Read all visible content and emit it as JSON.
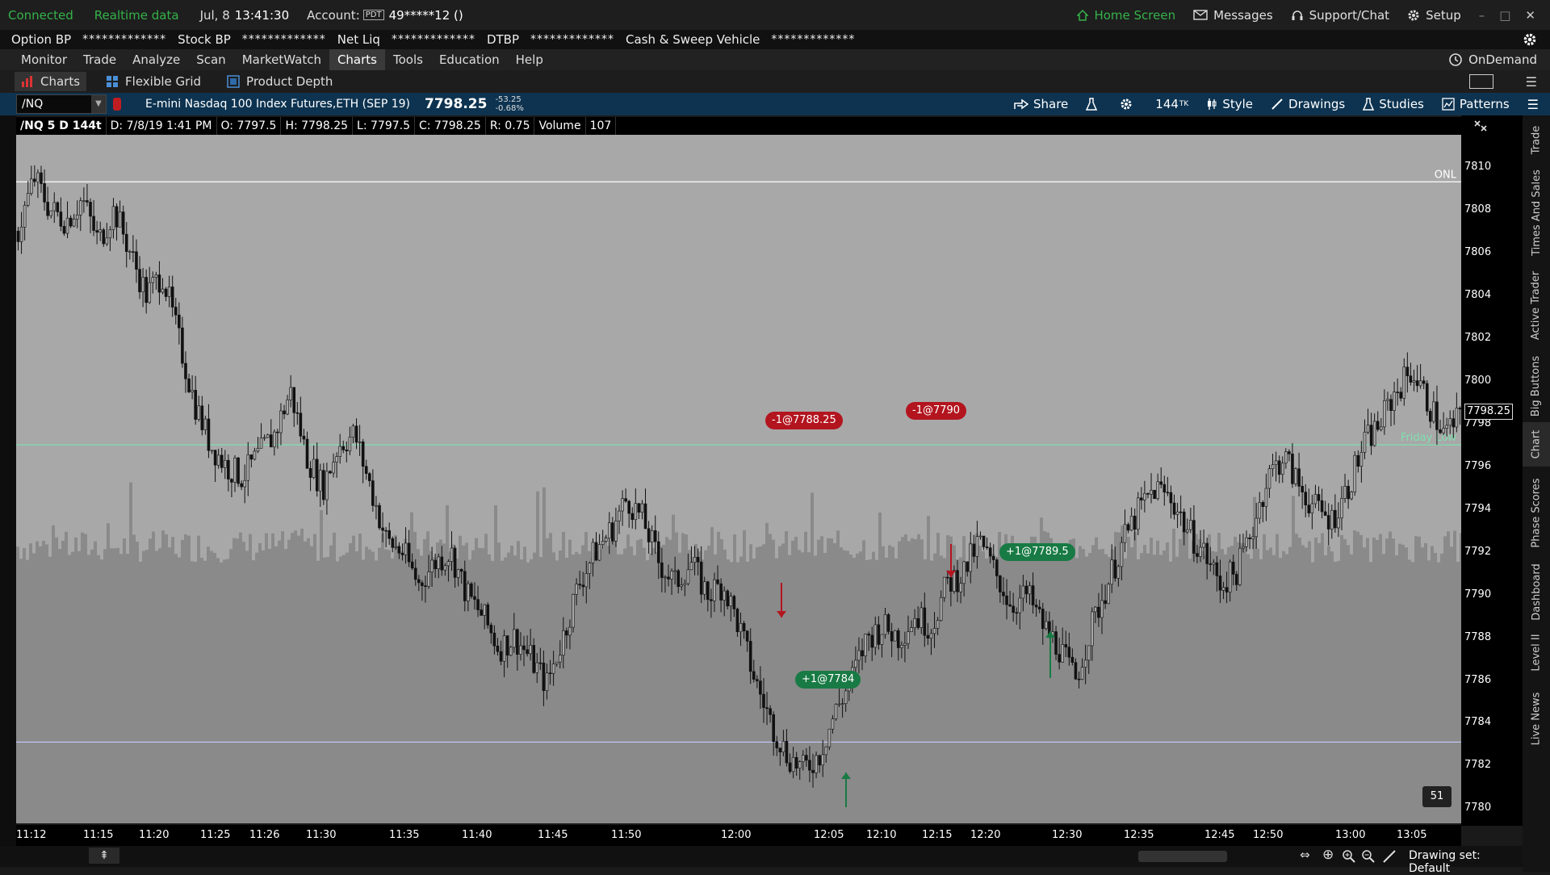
{
  "status": {
    "connected": "Connected",
    "realtime": "Realtime data",
    "date": "Jul, 8",
    "time": "13:41:30",
    "account_label": "Account:",
    "account_tag": "PDT",
    "account_value": "49*****12 ()",
    "home_screen": "Home Screen",
    "messages": "Messages",
    "support": "Support/Chat",
    "setup": "Setup"
  },
  "buying_power": [
    {
      "label": "Option BP",
      "value": "*************"
    },
    {
      "label": "Stock BP",
      "value": "*************"
    },
    {
      "label": "Net Liq",
      "value": "*************"
    },
    {
      "label": "DTBP",
      "value": "*************"
    },
    {
      "label": "Cash & Sweep Vehicle",
      "value": "*************"
    }
  ],
  "menu": [
    "Monitor",
    "Trade",
    "Analyze",
    "Scan",
    "MarketWatch",
    "Charts",
    "Tools",
    "Education",
    "Help"
  ],
  "ondemand": "OnDemand",
  "subtabs": [
    "Charts",
    "Flexible Grid",
    "Product Depth"
  ],
  "symbol": {
    "ticker": "/NQ",
    "description": "E-mini Nasdaq 100 Index Futures,ETH (SEP 19)",
    "price": "7798.25",
    "change": "-53.25",
    "change_pct": "-0.68%"
  },
  "toolbar": {
    "share": "Share",
    "ticks": "144",
    "ticks_unit": "TK",
    "style": "Style",
    "drawings": "Drawings",
    "studies": "Studies",
    "patterns": "Patterns"
  },
  "ohlc": {
    "title": "/NQ 5 D 144t",
    "date": "D: 7/8/19 1:41 PM",
    "open": "O: 7797.5",
    "high": "H: 7798.25",
    "low": "L: 7797.5",
    "close": "C: 7798.25",
    "range": "R: 0.75",
    "volume_label": "Volume",
    "volume_value": "107"
  },
  "right_tabs": [
    "Trade",
    "Times And Sales",
    "Active Trader",
    "Big Buttons",
    "Chart",
    "Phase Scores",
    "Dashboard",
    "Level II",
    "Live News"
  ],
  "chart_data": {
    "type": "candlestick",
    "price_ticks": [
      "7810",
      "7808",
      "7806",
      "7804",
      "7802",
      "7800",
      "7798",
      "7796",
      "7794",
      "7792",
      "7790",
      "7788",
      "7786",
      "7784",
      "7782",
      "7780"
    ],
    "ylim": [
      7779.3,
      7811.5
    ],
    "time_ticks": [
      "11:12",
      "11:15",
      "11:20",
      "11:25",
      "11:26",
      "11:30",
      "11:35",
      "11:40",
      "11:45",
      "11:50",
      "12:00",
      "12:05",
      "12:10",
      "12:15",
      "12:20",
      "12:30",
      "12:35",
      "12:45",
      "12:50",
      "13:00",
      "13:05"
    ],
    "current_price": "7798.25",
    "lines": [
      {
        "label": "ONL",
        "value": 7809.3,
        "color": "#ffffff"
      },
      {
        "label": "Friday Low",
        "value": 7797.0,
        "color": "#7fe0b0"
      },
      {
        "label": "",
        "value": 7783.1,
        "color": "#c8c8ff"
      }
    ],
    "close_path": [
      7807.0,
      7809.5,
      7808.0,
      7807.5,
      7808.5,
      7806.5,
      7808.0,
      7806.0,
      7804.0,
      7805.0,
      7802.0,
      7799.0,
      7797.0,
      7796.0,
      7795.5,
      7796.5,
      7797.5,
      7799.5,
      7796.5,
      7795.0,
      7797.0,
      7797.5,
      7795.0,
      7792.5,
      7792.0,
      7790.5,
      7791.5,
      7792.0,
      7790.0,
      7789.0,
      7787.5,
      7788.0,
      7787.0,
      7785.8,
      7788.0,
      7790.5,
      7792.0,
      7793.0,
      7794.5,
      7793.5,
      7791.5,
      7790.5,
      7791.5,
      7790.0,
      7790.5,
      7788.5,
      7786.0,
      7784.0,
      7782.5,
      7781.8,
      7782.5,
      7784.5,
      7786.0,
      7788.0,
      7788.5,
      7788.0,
      7789.0,
      7788.5,
      7790.5,
      7791.0,
      7792.5,
      7791.0,
      7789.5,
      7790.0,
      7788.5,
      7787.5,
      7786.0,
      7788.5,
      7790.5,
      7792.5,
      7794.0,
      7795.0,
      7794.5,
      7793.0,
      7792.0,
      7790.5,
      7791.0,
      7793.0,
      7795.5,
      7796.5,
      7795.0,
      7794.0,
      7793.5,
      7795.0,
      7797.0,
      7798.0,
      7799.5,
      7800.5,
      7799.0,
      7797.5,
      7798.25
    ],
    "trades": [
      {
        "label": "-1@7788.25",
        "side": "sell",
        "time_index": 33
      },
      {
        "label": "-1@7790",
        "side": "sell",
        "time_index": 46
      },
      {
        "label": "+1@7784",
        "side": "buy",
        "time_index": 40
      },
      {
        "label": "+1@7789.5",
        "side": "buy",
        "time_index": 50
      }
    ],
    "bar_count": "51"
  },
  "bottom": {
    "drawing_set": "Drawing set: Default"
  },
  "colors": {
    "chart_bg": "#a8a8a8",
    "volume": "#8a8a8a",
    "candle": "#111111",
    "sell": "#b3151f",
    "buy": "#187a44",
    "symbol_bar": "#0d3350",
    "connected": "#35b24a"
  }
}
